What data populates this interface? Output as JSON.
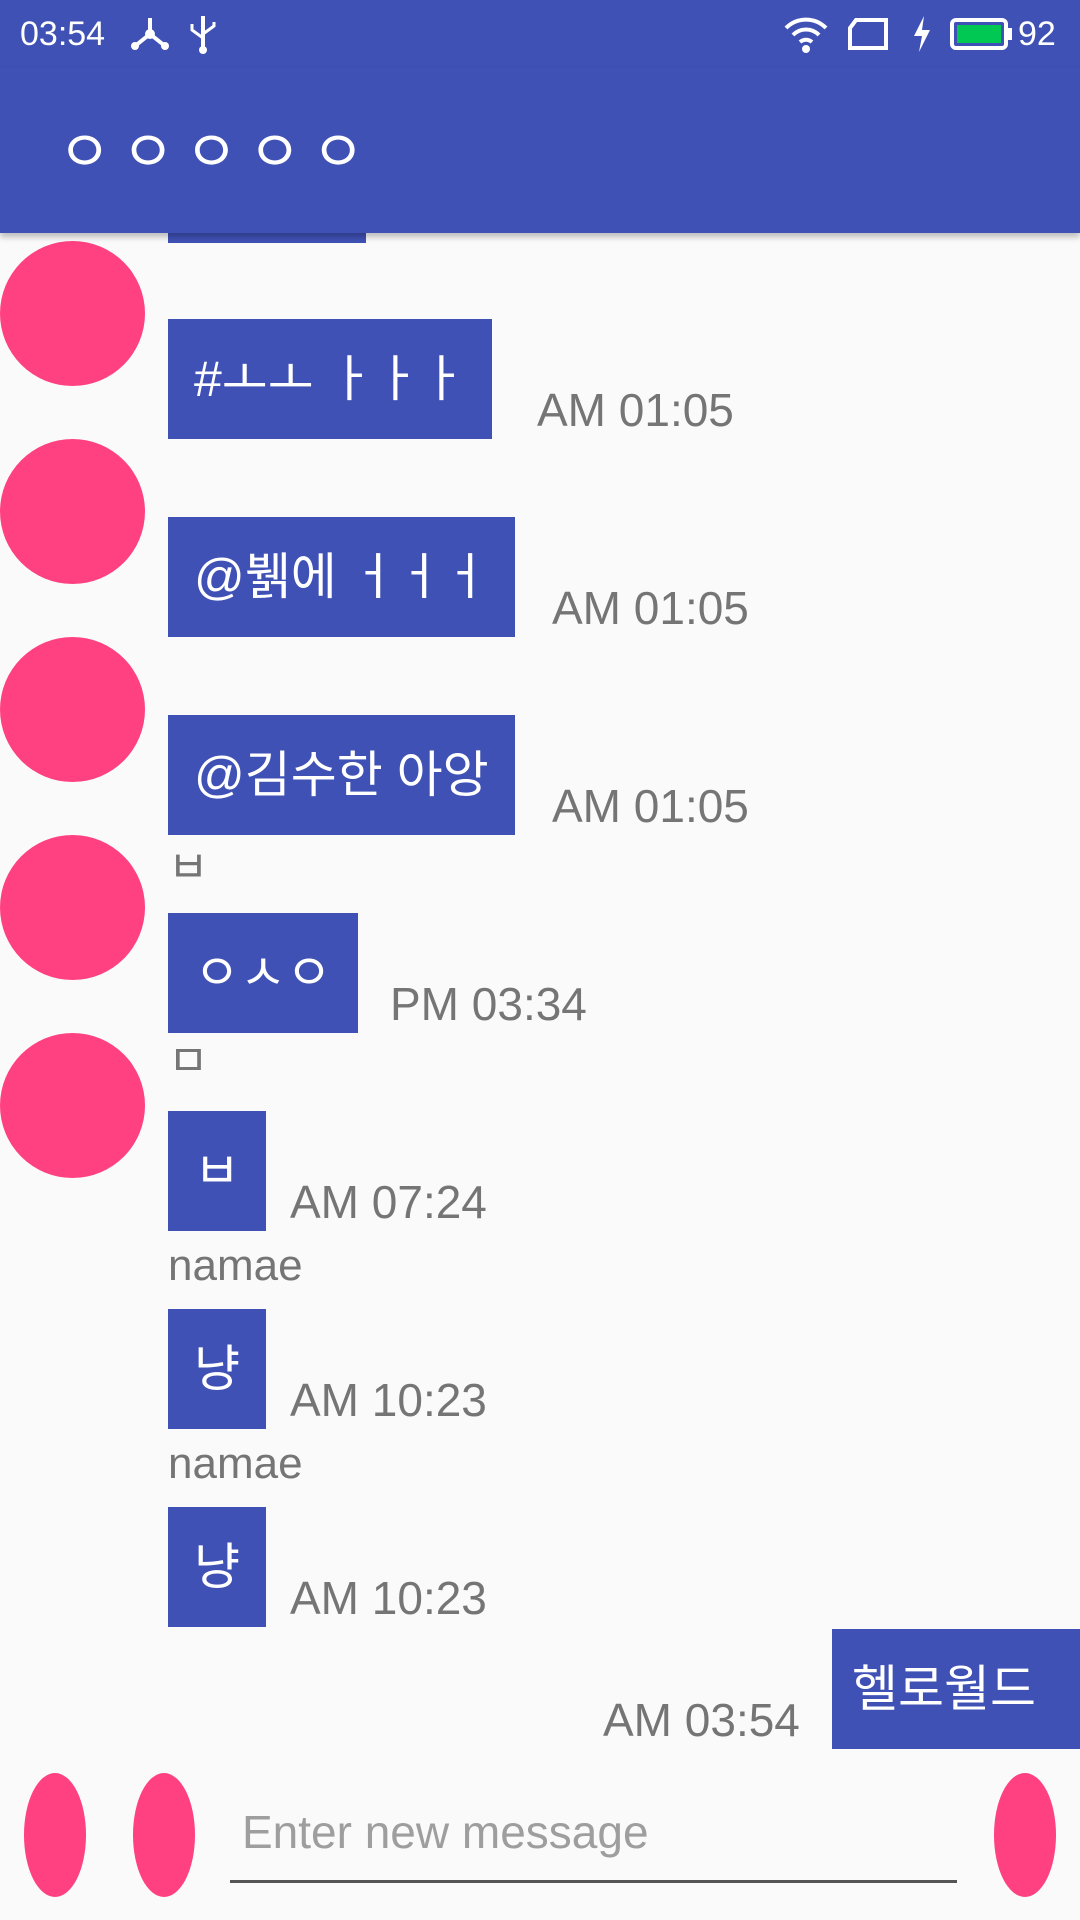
{
  "status_bar": {
    "time": "03:54",
    "battery_percent": "92",
    "icons": [
      "share-icon",
      "usb-icon",
      "wifi-icon",
      "sim-icon",
      "charging-icon",
      "battery-icon"
    ]
  },
  "app_bar": {
    "title": "ㅇㅇㅇㅇㅇ"
  },
  "messages": [
    {
      "text": "#ㅗㅗ ㅏㅏㅏ",
      "time": "AM 01:05"
    },
    {
      "text": "@뷁에 ㅓㅓㅓ",
      "time": "AM 01:05"
    },
    {
      "text": "@김수한 아앙",
      "time": "AM 01:05",
      "name_below": "ㅂ"
    },
    {
      "text": "ㅇㅅㅇ",
      "time": "PM 03:34",
      "name_below": "ㅁ"
    },
    {
      "text": "ㅂ",
      "time": "AM 07:24",
      "name_below": "namae"
    },
    {
      "text": "냥",
      "time": "AM 10:23",
      "name_below": "namae"
    },
    {
      "text": "냥",
      "time": "AM 10:23"
    }
  ],
  "outgoing": {
    "text": "헬로월드",
    "time": "AM 03:54"
  },
  "input": {
    "placeholder": "Enter new message"
  },
  "colors": {
    "primary": "#3f51b5",
    "accent": "#ff4081",
    "background": "#fafafa"
  }
}
